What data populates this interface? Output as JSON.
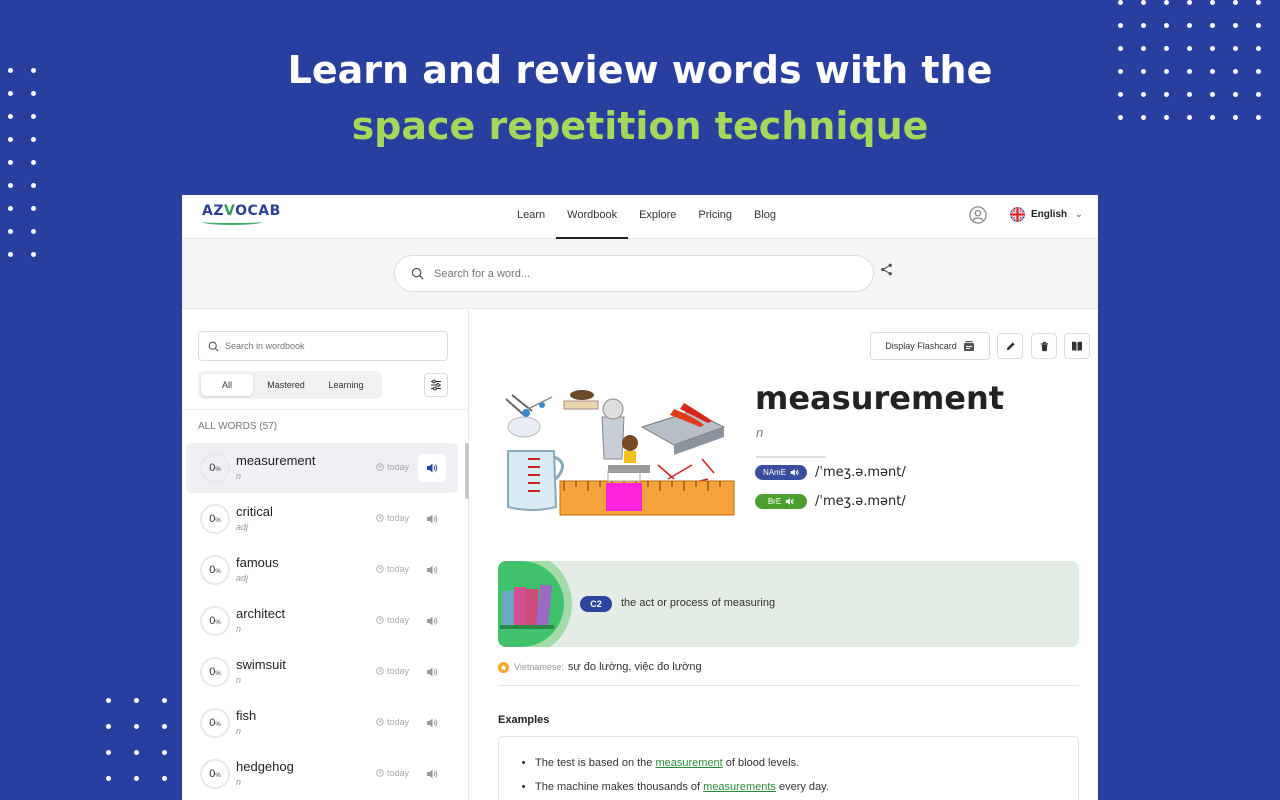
{
  "hero": {
    "line1": "Learn and review words with the",
    "line2": "space repetition technique"
  },
  "colors": {
    "background": "#283fa0",
    "accent_green": "#a6d65a",
    "name_badge": "#3a4e9e",
    "bre_badge": "#4c9f2f",
    "level_badge": "#2b44a0"
  },
  "nav": {
    "logo": "AZVOCAB",
    "links": [
      "Learn",
      "Wordbook",
      "Explore",
      "Pricing",
      "Blog"
    ],
    "active": "Wordbook",
    "language": "English"
  },
  "search": {
    "placeholder": "Search for a word..."
  },
  "sidebar": {
    "search_placeholder": "Search in wordbook",
    "filters": [
      "All",
      "Mastered",
      "Learning"
    ],
    "active_filter": "All",
    "all_words_label": "ALL WORDS (57)",
    "words": [
      {
        "word": "measurement",
        "pos": "n",
        "progress": "0",
        "due": "today",
        "selected": true
      },
      {
        "word": "critical",
        "pos": "adj",
        "progress": "0",
        "due": "today"
      },
      {
        "word": "famous",
        "pos": "adj",
        "progress": "0",
        "due": "today"
      },
      {
        "word": "architect",
        "pos": "n",
        "progress": "0",
        "due": "today"
      },
      {
        "word": "swimsuit",
        "pos": "n",
        "progress": "0",
        "due": "today"
      },
      {
        "word": "fish",
        "pos": "n",
        "progress": "0",
        "due": "today"
      },
      {
        "word": "hedgehog",
        "pos": "n",
        "progress": "0",
        "due": "today"
      }
    ],
    "progress_unit": "%"
  },
  "detail": {
    "display_flashcard": "Display Flashcard",
    "headword": "measurement",
    "pos": "n",
    "pron_name_label": "NAmE",
    "pron_name_ipa": "/ˈmeʒ.ə.mənt/",
    "pron_bre_label": "BrE",
    "pron_bre_ipa": "/ˈmeʒ.ə.mənt/",
    "level": "C2",
    "definition": "the act or process of measuring",
    "translation_label": "Vietnamese:",
    "translation": "sự đo lường, việc đo lường",
    "examples_title": "Examples",
    "examples": [
      {
        "before": "The test is based on the ",
        "term": "measurement",
        "after": " of blood levels."
      },
      {
        "before": "The machine makes thousands of ",
        "term": "measurements",
        "after": " every day."
      }
    ]
  }
}
